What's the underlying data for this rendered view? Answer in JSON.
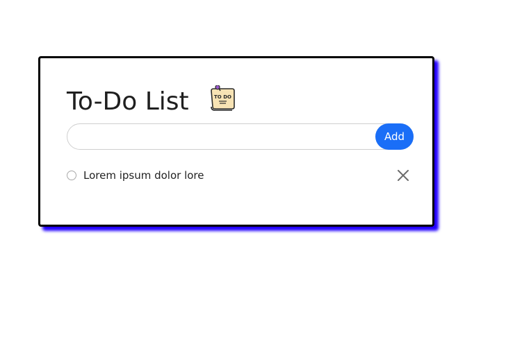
{
  "app": {
    "title": "To-Do List",
    "icon": "todo-note-icon",
    "icon_text": "TO DO"
  },
  "input": {
    "value": "",
    "placeholder": ""
  },
  "add_button": {
    "label": "Add"
  },
  "tasks": [
    {
      "text": "Lorem ipsum dolor lore",
      "checked": false
    }
  ],
  "colors": {
    "accent": "#1a6ef7",
    "shadow": "#2200ff",
    "border": "#000000"
  }
}
